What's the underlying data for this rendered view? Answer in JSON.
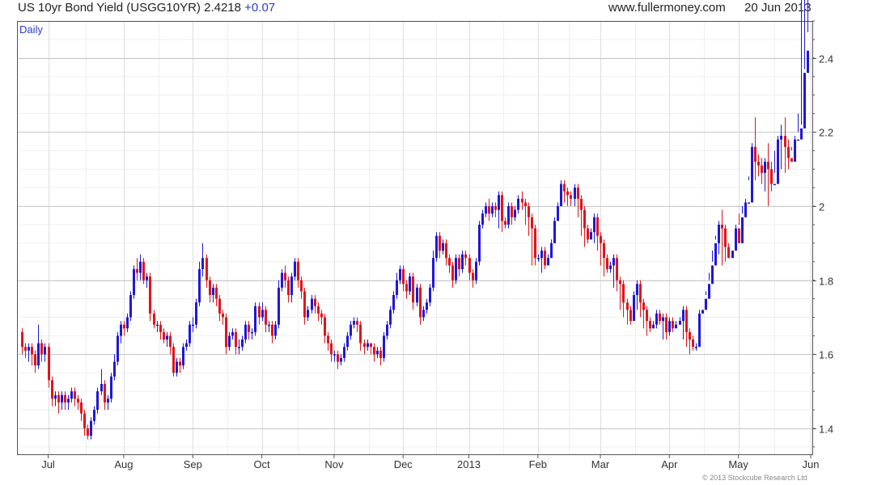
{
  "header": {
    "title": "US 10yr Bond Yield (USGG10YR)",
    "last": "2.4218",
    "change": "+0.07",
    "site": "www.fullermoney.com",
    "date": "20 Jun 2013"
  },
  "copyright": "© 2013 Stockcube Research Ltd",
  "colors": {
    "up": "#1f17d9",
    "down": "#e0141c",
    "grid": "#dedede",
    "axis": "#555555",
    "label_blue": "#2a3bd6"
  },
  "chart_data": {
    "type": "candlestick",
    "interval_label": "Daily",
    "ylim": [
      1.33,
      2.5
    ],
    "yticks": [
      1.4,
      1.6,
      1.8,
      2.0,
      2.2,
      2.4
    ],
    "ytick_labels": [
      "1.4",
      "1.6",
      "1.8",
      "2",
      "2.2",
      "2.4"
    ],
    "x_tick_labels": [
      "Jul",
      "Aug",
      "Sep",
      "Oct",
      "Nov",
      "Dec",
      "2013",
      "Feb",
      "Mar",
      "Apr",
      "May",
      "Jun"
    ],
    "x_tick_index": [
      8,
      31,
      52,
      73,
      95,
      116,
      136,
      157,
      176,
      197,
      218,
      240
    ],
    "grid": true,
    "close": [
      1.62,
      1.61,
      1.62,
      1.6,
      1.57,
      1.63,
      1.6,
      1.62,
      1.53,
      1.48,
      1.49,
      1.47,
      1.49,
      1.47,
      1.48,
      1.5,
      1.48,
      1.47,
      1.44,
      1.4,
      1.38,
      1.42,
      1.45,
      1.5,
      1.52,
      1.47,
      1.48,
      1.54,
      1.58,
      1.65,
      1.68,
      1.67,
      1.7,
      1.76,
      1.83,
      1.82,
      1.85,
      1.8,
      1.81,
      1.71,
      1.68,
      1.68,
      1.66,
      1.64,
      1.65,
      1.62,
      1.55,
      1.58,
      1.57,
      1.62,
      1.63,
      1.68,
      1.68,
      1.74,
      1.83,
      1.86,
      1.8,
      1.76,
      1.78,
      1.75,
      1.71,
      1.7,
      1.62,
      1.65,
      1.66,
      1.62,
      1.62,
      1.64,
      1.68,
      1.66,
      1.66,
      1.73,
      1.7,
      1.72,
      1.68,
      1.68,
      1.65,
      1.68,
      1.78,
      1.82,
      1.8,
      1.76,
      1.81,
      1.85,
      1.8,
      1.77,
      1.7,
      1.72,
      1.75,
      1.73,
      1.71,
      1.7,
      1.65,
      1.63,
      1.6,
      1.6,
      1.58,
      1.59,
      1.62,
      1.65,
      1.68,
      1.69,
      1.68,
      1.63,
      1.62,
      1.63,
      1.62,
      1.6,
      1.61,
      1.59,
      1.65,
      1.68,
      1.72,
      1.76,
      1.8,
      1.83,
      1.79,
      1.77,
      1.81,
      1.74,
      1.78,
      1.7,
      1.72,
      1.74,
      1.78,
      1.86,
      1.92,
      1.88,
      1.9,
      1.86,
      1.84,
      1.8,
      1.86,
      1.83,
      1.87,
      1.86,
      1.82,
      1.8,
      1.85,
      1.95,
      1.98,
      2.0,
      1.98,
      2.0,
      1.99,
      2.03,
      1.96,
      1.95,
      2.0,
      1.97,
      1.99,
      2.02,
      2.01,
      2.0,
      1.97,
      1.94,
      1.86,
      1.86,
      1.88,
      1.84,
      1.86,
      1.9,
      1.96,
      2.0,
      2.06,
      2.04,
      2.03,
      2.02,
      2.05,
      2.02,
      1.99,
      1.94,
      1.91,
      1.93,
      1.97,
      1.92,
      1.9,
      1.86,
      1.83,
      1.84,
      1.86,
      1.8,
      1.79,
      1.74,
      1.72,
      1.69,
      1.76,
      1.79,
      1.74,
      1.72,
      1.69,
      1.67,
      1.68,
      1.71,
      1.69,
      1.7,
      1.66,
      1.69,
      1.67,
      1.68,
      1.69,
      1.72,
      1.66,
      1.64,
      1.62,
      1.62,
      1.71,
      1.72,
      1.75,
      1.79,
      1.84,
      1.9,
      1.95,
      1.94,
      1.89,
      1.86,
      1.88,
      1.94,
      1.9,
      1.97,
      2.01,
      2.01,
      2.16,
      2.12,
      2.11,
      2.09,
      2.12,
      2.1,
      2.06,
      2.06,
      2.18,
      2.19,
      2.16,
      2.13,
      2.12,
      2.18,
      2.18,
      2.21,
      2.36,
      2.42
    ],
    "open": [
      1.66,
      1.62,
      1.61,
      1.62,
      1.6,
      1.57,
      1.63,
      1.6,
      1.62,
      1.53,
      1.48,
      1.49,
      1.47,
      1.49,
      1.47,
      1.48,
      1.5,
      1.48,
      1.47,
      1.44,
      1.4,
      1.38,
      1.42,
      1.45,
      1.5,
      1.52,
      1.47,
      1.48,
      1.54,
      1.58,
      1.65,
      1.68,
      1.67,
      1.7,
      1.76,
      1.83,
      1.82,
      1.85,
      1.8,
      1.81,
      1.71,
      1.68,
      1.68,
      1.66,
      1.64,
      1.65,
      1.62,
      1.55,
      1.58,
      1.57,
      1.62,
      1.63,
      1.68,
      1.68,
      1.74,
      1.83,
      1.86,
      1.8,
      1.76,
      1.78,
      1.75,
      1.71,
      1.7,
      1.62,
      1.65,
      1.66,
      1.62,
      1.62,
      1.64,
      1.68,
      1.66,
      1.66,
      1.73,
      1.7,
      1.72,
      1.68,
      1.68,
      1.65,
      1.68,
      1.78,
      1.82,
      1.8,
      1.76,
      1.81,
      1.85,
      1.8,
      1.77,
      1.7,
      1.72,
      1.75,
      1.73,
      1.71,
      1.7,
      1.65,
      1.63,
      1.6,
      1.6,
      1.58,
      1.59,
      1.62,
      1.65,
      1.68,
      1.69,
      1.68,
      1.63,
      1.62,
      1.63,
      1.62,
      1.6,
      1.61,
      1.59,
      1.65,
      1.68,
      1.72,
      1.76,
      1.8,
      1.83,
      1.79,
      1.77,
      1.81,
      1.74,
      1.78,
      1.7,
      1.72,
      1.74,
      1.78,
      1.86,
      1.92,
      1.88,
      1.9,
      1.86,
      1.84,
      1.8,
      1.86,
      1.83,
      1.87,
      1.86,
      1.82,
      1.8,
      1.85,
      1.95,
      1.98,
      2.0,
      1.98,
      2.0,
      1.99,
      2.03,
      1.96,
      1.95,
      2.0,
      1.97,
      1.99,
      2.02,
      2.01,
      2.0,
      1.97,
      1.94,
      1.86,
      1.86,
      1.88,
      1.84,
      1.86,
      1.9,
      1.96,
      2.0,
      2.06,
      2.04,
      2.03,
      2.02,
      2.05,
      2.02,
      1.99,
      1.94,
      1.91,
      1.93,
      1.97,
      1.92,
      1.9,
      1.86,
      1.83,
      1.84,
      1.86,
      1.8,
      1.79,
      1.74,
      1.72,
      1.69,
      1.76,
      1.79,
      1.74,
      1.72,
      1.69,
      1.67,
      1.68,
      1.71,
      1.69,
      1.7,
      1.66,
      1.69,
      1.67,
      1.68,
      1.69,
      1.72,
      1.66,
      1.64,
      1.62,
      1.62,
      1.71,
      1.72,
      1.75,
      1.79,
      1.84,
      1.9,
      1.95,
      1.94,
      1.89,
      1.86,
      1.88,
      1.94,
      1.9,
      1.97,
      2.01,
      2.01,
      2.16,
      2.12,
      2.11,
      2.09,
      2.12,
      2.1,
      2.06,
      2.06,
      2.18,
      2.19,
      2.16,
      2.13,
      2.12,
      2.18,
      2.18,
      2.21,
      2.36
    ],
    "high": [
      1.67,
      1.63,
      1.63,
      1.63,
      1.61,
      1.68,
      1.64,
      1.63,
      1.63,
      1.54,
      1.5,
      1.5,
      1.5,
      1.5,
      1.49,
      1.51,
      1.51,
      1.49,
      1.48,
      1.45,
      1.41,
      1.43,
      1.46,
      1.51,
      1.56,
      1.53,
      1.49,
      1.55,
      1.6,
      1.66,
      1.69,
      1.69,
      1.71,
      1.77,
      1.84,
      1.86,
      1.87,
      1.86,
      1.82,
      1.82,
      1.72,
      1.69,
      1.69,
      1.67,
      1.66,
      1.66,
      1.63,
      1.59,
      1.59,
      1.63,
      1.64,
      1.69,
      1.7,
      1.75,
      1.85,
      1.9,
      1.87,
      1.81,
      1.79,
      1.79,
      1.76,
      1.72,
      1.71,
      1.66,
      1.67,
      1.67,
      1.64,
      1.65,
      1.69,
      1.69,
      1.67,
      1.74,
      1.74,
      1.74,
      1.73,
      1.69,
      1.69,
      1.69,
      1.8,
      1.83,
      1.84,
      1.81,
      1.82,
      1.86,
      1.86,
      1.81,
      1.78,
      1.73,
      1.76,
      1.76,
      1.74,
      1.72,
      1.71,
      1.66,
      1.64,
      1.61,
      1.61,
      1.6,
      1.63,
      1.66,
      1.69,
      1.7,
      1.7,
      1.69,
      1.64,
      1.64,
      1.63,
      1.63,
      1.62,
      1.62,
      1.66,
      1.69,
      1.73,
      1.77,
      1.82,
      1.84,
      1.84,
      1.8,
      1.82,
      1.82,
      1.79,
      1.79,
      1.73,
      1.75,
      1.79,
      1.88,
      1.93,
      1.93,
      1.91,
      1.91,
      1.87,
      1.85,
      1.87,
      1.87,
      1.88,
      1.88,
      1.87,
      1.83,
      1.86,
      1.96,
      1.99,
      2.01,
      2.02,
      2.01,
      2.01,
      2.04,
      2.04,
      1.97,
      2.01,
      2.01,
      2.0,
      2.03,
      2.04,
      2.02,
      2.01,
      1.98,
      1.95,
      1.87,
      1.89,
      1.89,
      1.87,
      1.91,
      1.97,
      2.01,
      2.07,
      2.07,
      2.05,
      2.04,
      2.06,
      2.06,
      2.03,
      2.0,
      1.95,
      1.94,
      1.98,
      1.98,
      1.93,
      1.91,
      1.87,
      1.85,
      1.87,
      1.87,
      1.81,
      1.8,
      1.75,
      1.73,
      1.77,
      1.8,
      1.8,
      1.75,
      1.73,
      1.7,
      1.69,
      1.72,
      1.72,
      1.71,
      1.71,
      1.7,
      1.7,
      1.69,
      1.7,
      1.73,
      1.73,
      1.67,
      1.65,
      1.63,
      1.72,
      1.73,
      1.76,
      1.8,
      1.85,
      1.91,
      1.96,
      1.99,
      1.95,
      1.9,
      1.89,
      1.95,
      1.98,
      1.98,
      2.02,
      2.07,
      2.17,
      2.24,
      2.14,
      2.13,
      2.13,
      2.17,
      2.12,
      2.09,
      2.19,
      2.22,
      2.24,
      2.18,
      2.15,
      2.19,
      2.25,
      2.22,
      2.37,
      2.47
    ],
    "low": [
      1.6,
      1.59,
      1.58,
      1.57,
      1.55,
      1.56,
      1.58,
      1.58,
      1.51,
      1.46,
      1.46,
      1.44,
      1.45,
      1.45,
      1.45,
      1.47,
      1.46,
      1.45,
      1.42,
      1.38,
      1.37,
      1.37,
      1.41,
      1.44,
      1.49,
      1.45,
      1.45,
      1.47,
      1.53,
      1.57,
      1.63,
      1.65,
      1.66,
      1.69,
      1.75,
      1.8,
      1.8,
      1.79,
      1.78,
      1.69,
      1.67,
      1.66,
      1.64,
      1.63,
      1.62,
      1.6,
      1.54,
      1.54,
      1.55,
      1.56,
      1.61,
      1.62,
      1.66,
      1.67,
      1.73,
      1.81,
      1.78,
      1.74,
      1.74,
      1.73,
      1.69,
      1.68,
      1.6,
      1.61,
      1.64,
      1.6,
      1.6,
      1.61,
      1.63,
      1.64,
      1.64,
      1.65,
      1.68,
      1.69,
      1.66,
      1.66,
      1.63,
      1.64,
      1.67,
      1.77,
      1.78,
      1.74,
      1.74,
      1.8,
      1.78,
      1.75,
      1.68,
      1.69,
      1.71,
      1.71,
      1.69,
      1.68,
      1.63,
      1.61,
      1.58,
      1.58,
      1.56,
      1.57,
      1.58,
      1.61,
      1.64,
      1.67,
      1.66,
      1.61,
      1.6,
      1.61,
      1.6,
      1.58,
      1.59,
      1.57,
      1.58,
      1.64,
      1.67,
      1.71,
      1.75,
      1.79,
      1.77,
      1.75,
      1.76,
      1.72,
      1.73,
      1.68,
      1.69,
      1.71,
      1.73,
      1.77,
      1.85,
      1.86,
      1.87,
      1.84,
      1.82,
      1.78,
      1.79,
      1.81,
      1.82,
      1.84,
      1.8,
      1.78,
      1.79,
      1.84,
      1.94,
      1.97,
      1.96,
      1.97,
      1.97,
      1.94,
      1.93,
      1.94,
      1.94,
      1.95,
      1.96,
      1.98,
      1.99,
      1.95,
      1.92,
      1.84,
      1.84,
      1.85,
      1.82,
      1.83,
      1.85,
      1.89,
      1.95,
      1.99,
      2.02,
      2.01,
      2.0,
      2.0,
      2.0,
      1.97,
      1.92,
      1.89,
      1.9,
      1.92,
      1.9,
      1.88,
      1.84,
      1.81,
      1.82,
      1.82,
      1.78,
      1.77,
      1.72,
      1.7,
      1.68,
      1.68,
      1.74,
      1.72,
      1.7,
      1.67,
      1.65,
      1.66,
      1.67,
      1.67,
      1.68,
      1.64,
      1.64,
      1.65,
      1.66,
      1.67,
      1.68,
      1.64,
      1.62,
      1.6,
      1.61,
      1.61,
      1.7,
      1.73,
      1.77,
      1.82,
      1.88,
      1.92,
      1.87,
      1.84,
      1.85,
      1.86,
      1.89,
      1.89,
      1.95,
      2.0,
      2.0,
      2.08,
      2.09,
      2.07,
      2.08,
      2.06,
      2.04,
      2.0,
      2.04,
      2.15,
      2.13,
      2.1,
      2.09,
      2.1,
      2.16,
      2.17,
      2.2
    ]
  }
}
